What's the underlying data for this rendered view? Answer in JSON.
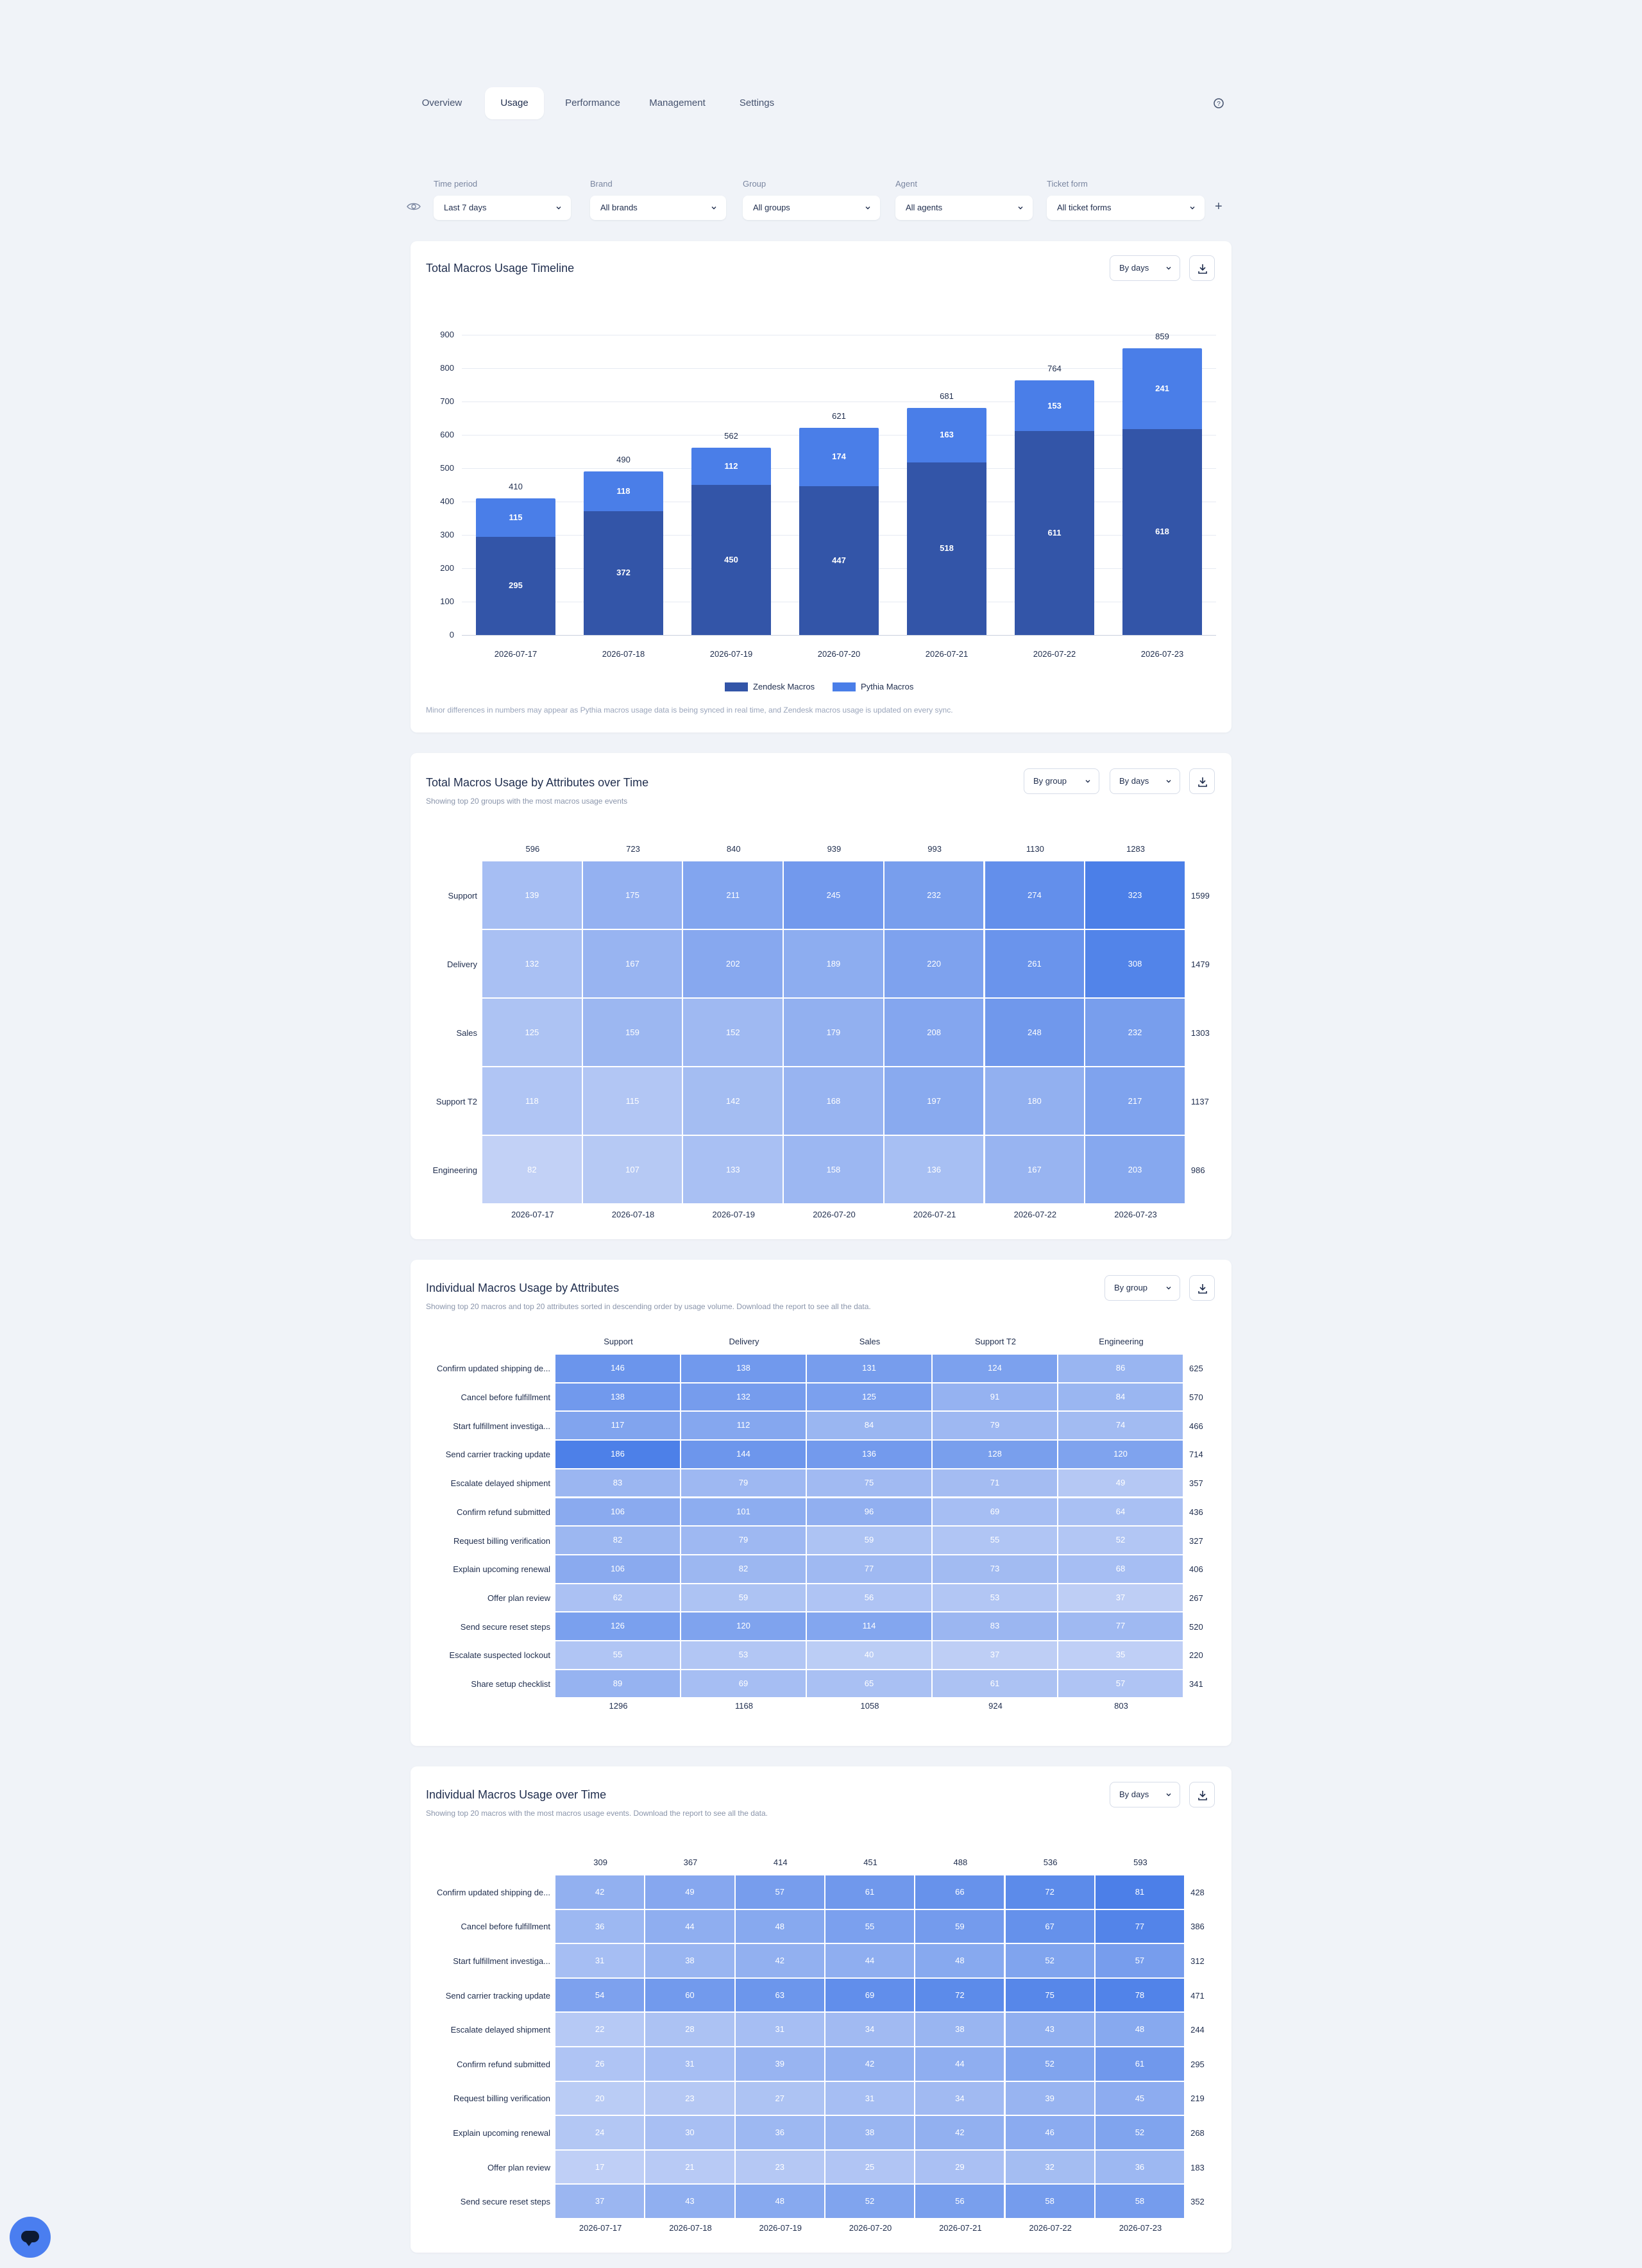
{
  "nav": {
    "tabs": [
      "Overview",
      "Usage",
      "Performance",
      "Management",
      "Settings"
    ],
    "active_tab": "Usage",
    "help_icon": "help-circle-icon"
  },
  "filters": [
    {
      "label": "Time period",
      "value": "Last 7 days"
    },
    {
      "label": "Brand",
      "value": "All brands"
    },
    {
      "label": "Group",
      "value": "All groups"
    },
    {
      "label": "Agent",
      "value": "All agents"
    },
    {
      "label": "Ticket form",
      "value": "All ticket forms"
    }
  ],
  "filter_icons": {
    "visibility": "eye-icon",
    "add": "plus-icon"
  },
  "timeline": {
    "title": "Total Macros Usage Timeline",
    "dropdown": "By days",
    "download_icon": "download-icon",
    "footnote": "Minor differences in numbers may appear as Pythia macros usage data is being synced in real time, and Zendesk macros usage is updated on every sync.",
    "legend": [
      "Zendesk Macros",
      "Pythia Macros"
    ]
  },
  "chart_data": {
    "type": "bar",
    "stacked": true,
    "categories": [
      "2026-07-17",
      "2026-07-18",
      "2026-07-19",
      "2026-07-20",
      "2026-07-21",
      "2026-07-22",
      "2026-07-23"
    ],
    "series": [
      {
        "name": "Zendesk Macros",
        "values": [
          295,
          372,
          450,
          447,
          518,
          611,
          618
        ],
        "color": "#3355a8"
      },
      {
        "name": "Pythia Macros",
        "values": [
          115,
          118,
          112,
          174,
          163,
          153,
          241
        ],
        "color": "#4a7ee8"
      }
    ],
    "totals": [
      410,
      490,
      562,
      621,
      681,
      764,
      859
    ],
    "yticks": [
      0,
      100,
      200,
      300,
      400,
      500,
      600,
      700,
      800,
      900
    ],
    "ylim": [
      0,
      900
    ],
    "grid": true,
    "legend_position": "bottom"
  },
  "attributes_time": {
    "title": "Total Macros Usage by Attributes over Time",
    "subtitle": "Showing top 20 groups with the most macros usage events",
    "dropdown_group": "By group",
    "dropdown_days": "By days",
    "columns": [
      "2026-07-17",
      "2026-07-18",
      "2026-07-19",
      "2026-07-20",
      "2026-07-21",
      "2026-07-22",
      "2026-07-23"
    ],
    "column_totals": [
      596,
      723,
      840,
      939,
      993,
      1130,
      1283
    ],
    "rows": [
      {
        "label": "Support",
        "values": [
          139,
          175,
          211,
          245,
          232,
          274,
          323
        ],
        "total": 1599
      },
      {
        "label": "Delivery",
        "values": [
          132,
          167,
          202,
          189,
          220,
          261,
          308
        ],
        "total": 1479
      },
      {
        "label": "Sales",
        "values": [
          125,
          159,
          152,
          179,
          208,
          248,
          232
        ],
        "total": 1303
      },
      {
        "label": "Support T2",
        "values": [
          118,
          115,
          142,
          168,
          197,
          180,
          217
        ],
        "total": 1137
      },
      {
        "label": "Engineering",
        "values": [
          82,
          107,
          133,
          158,
          136,
          167,
          203
        ],
        "total": 986
      }
    ],
    "scale": [
      80,
      325
    ]
  },
  "individual_attributes": {
    "title": "Individual Macros Usage by Attributes",
    "subtitle": "Showing top 20 macros and top 20 attributes sorted in descending order by usage volume. Download the report to see all the data.",
    "dropdown_group": "By group",
    "columns": [
      "Support",
      "Delivery",
      "Sales",
      "Support T2",
      "Engineering"
    ],
    "column_totals": [
      1296,
      1168,
      1058,
      924,
      803
    ],
    "rows": [
      {
        "label": "Confirm updated shipping de...",
        "values": [
          146,
          138,
          131,
          124,
          86
        ],
        "total": 625
      },
      {
        "label": "Cancel before fulfillment",
        "values": [
          138,
          132,
          125,
          91,
          84
        ],
        "total": 570
      },
      {
        "label": "Start fulfillment investiga...",
        "values": [
          117,
          112,
          84,
          79,
          74
        ],
        "total": 466
      },
      {
        "label": "Send carrier tracking update",
        "values": [
          186,
          144,
          136,
          128,
          120
        ],
        "total": 714
      },
      {
        "label": "Escalate delayed shipment",
        "values": [
          83,
          79,
          75,
          71,
          49
        ],
        "total": 357
      },
      {
        "label": "Confirm refund submitted",
        "values": [
          106,
          101,
          96,
          69,
          64
        ],
        "total": 436
      },
      {
        "label": "Request billing verification",
        "values": [
          82,
          79,
          59,
          55,
          52
        ],
        "total": 327
      },
      {
        "label": "Explain upcoming renewal",
        "values": [
          106,
          82,
          77,
          73,
          68
        ],
        "total": 406
      },
      {
        "label": "Offer plan review",
        "values": [
          62,
          59,
          56,
          53,
          37
        ],
        "total": 267
      },
      {
        "label": "Send secure reset steps",
        "values": [
          126,
          120,
          114,
          83,
          77
        ],
        "total": 520
      },
      {
        "label": "Escalate suspected lockout",
        "values": [
          55,
          53,
          40,
          37,
          35
        ],
        "total": 220
      },
      {
        "label": "Share setup checklist",
        "values": [
          89,
          69,
          65,
          61,
          57
        ],
        "total": 341
      }
    ],
    "scale": [
      30,
      190
    ]
  },
  "individual_time": {
    "title": "Individual Macros Usage over Time",
    "subtitle": "Showing top 20 macros with the most macros usage events. Download the report to see all the data.",
    "dropdown_days": "By days",
    "columns": [
      "2026-07-17",
      "2026-07-18",
      "2026-07-19",
      "2026-07-20",
      "2026-07-21",
      "2026-07-22",
      "2026-07-23"
    ],
    "column_totals": [
      309,
      367,
      414,
      451,
      488,
      536,
      593
    ],
    "rows": [
      {
        "label": "Confirm updated shipping de...",
        "values": [
          42,
          49,
          57,
          61,
          66,
          72,
          81
        ],
        "total": 428
      },
      {
        "label": "Cancel before fulfillment",
        "values": [
          36,
          44,
          48,
          55,
          59,
          67,
          77
        ],
        "total": 386
      },
      {
        "label": "Start fulfillment investiga...",
        "values": [
          31,
          38,
          42,
          44,
          48,
          52,
          57
        ],
        "total": 312
      },
      {
        "label": "Send carrier tracking update",
        "values": [
          54,
          60,
          63,
          69,
          72,
          75,
          78
        ],
        "total": 471
      },
      {
        "label": "Escalate delayed shipment",
        "values": [
          22,
          28,
          31,
          34,
          38,
          43,
          48
        ],
        "total": 244
      },
      {
        "label": "Confirm refund submitted",
        "values": [
          26,
          31,
          39,
          42,
          44,
          52,
          61
        ],
        "total": 295
      },
      {
        "label": "Request billing verification",
        "values": [
          20,
          23,
          27,
          31,
          34,
          39,
          45
        ],
        "total": 219
      },
      {
        "label": "Explain upcoming renewal",
        "values": [
          24,
          30,
          36,
          38,
          42,
          46,
          52
        ],
        "total": 268
      },
      {
        "label": "Offer plan review",
        "values": [
          17,
          21,
          23,
          25,
          29,
          32,
          36
        ],
        "total": 183
      },
      {
        "label": "Send secure reset steps",
        "values": [
          37,
          43,
          48,
          52,
          56,
          58,
          58
        ],
        "total": 352
      }
    ],
    "scale": [
      15,
      82
    ]
  },
  "chat_icon": "chat-bubble-icon",
  "colors": {
    "accent": "#4a7ee8",
    "dark_bar": "#3355a8",
    "heat_low": "#c3d2f6",
    "heat_high": "#4a7ee8"
  }
}
